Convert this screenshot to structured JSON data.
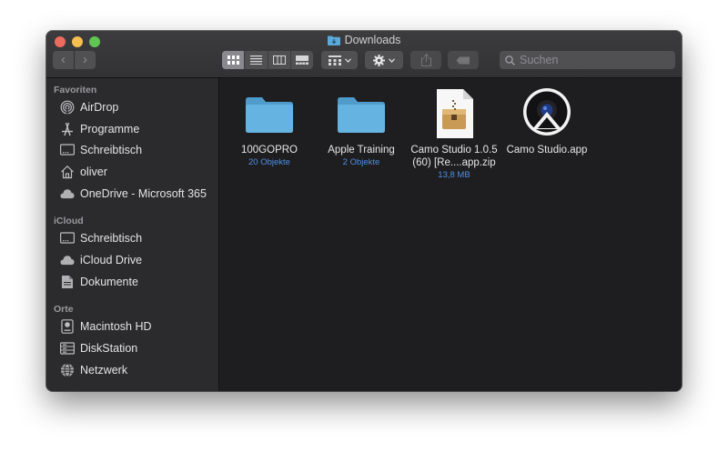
{
  "window": {
    "title": "Downloads",
    "toolbar": {
      "back_label": "‹",
      "forward_label": "›",
      "search_placeholder": "Suchen"
    }
  },
  "sidebar": {
    "sections": [
      {
        "label": "Favoriten",
        "items": [
          {
            "label": "AirDrop",
            "icon": "airdrop-icon"
          },
          {
            "label": "Programme",
            "icon": "applications-icon"
          },
          {
            "label": "Schreibtisch",
            "icon": "desktop-icon"
          },
          {
            "label": "oliver",
            "icon": "home-icon"
          },
          {
            "label": "OneDrive - Microsoft 365",
            "icon": "cloud-icon"
          }
        ]
      },
      {
        "label": "iCloud",
        "items": [
          {
            "label": "Schreibtisch",
            "icon": "desktop-icon"
          },
          {
            "label": "iCloud Drive",
            "icon": "cloud-icon"
          },
          {
            "label": "Dokumente",
            "icon": "document-icon"
          }
        ]
      },
      {
        "label": "Orte",
        "items": [
          {
            "label": "Macintosh HD",
            "icon": "hard-drive-icon"
          },
          {
            "label": "DiskStation",
            "icon": "server-icon"
          },
          {
            "label": "Netzwerk",
            "icon": "network-icon"
          }
        ]
      }
    ]
  },
  "files": [
    {
      "name_line1": "100GOPRO",
      "name_line2": "",
      "meta": "20 Objekte",
      "icon": "folder-icon"
    },
    {
      "name_line1": "Apple Training",
      "name_line2": "",
      "meta": "2 Objekte",
      "icon": "folder-icon"
    },
    {
      "name_line1": "Camo Studio 1.0.5",
      "name_line2": "(60) [Re....app.zip",
      "meta": "13,8 MB",
      "icon": "zip-archive-icon"
    },
    {
      "name_line1": "Camo Studio.app",
      "name_line2": "",
      "meta": "",
      "icon": "camo-app-icon"
    }
  ],
  "colors": {
    "folder": "#5aa9d6",
    "accent_meta": "#4d8fe6",
    "window_bg": "#1e1e20",
    "sidebar_bg": "#2b2b2e"
  }
}
